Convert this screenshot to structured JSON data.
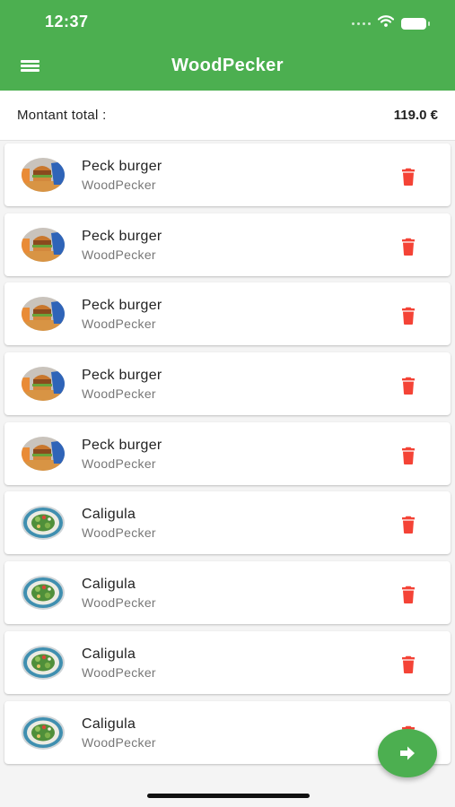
{
  "status_bar": {
    "time": "12:37"
  },
  "app_bar": {
    "title": "WoodPecker",
    "menu_icon": "hamburger-icon"
  },
  "cart": {
    "total_label": "Montant total :",
    "total_value": "119.0 €",
    "items": [
      {
        "name": "Peck burger",
        "restaurant": "WoodPecker",
        "thumb": "burger"
      },
      {
        "name": "Peck burger",
        "restaurant": "WoodPecker",
        "thumb": "burger"
      },
      {
        "name": "Peck burger",
        "restaurant": "WoodPecker",
        "thumb": "burger"
      },
      {
        "name": "Peck burger",
        "restaurant": "WoodPecker",
        "thumb": "burger"
      },
      {
        "name": "Peck burger",
        "restaurant": "WoodPecker",
        "thumb": "burger"
      },
      {
        "name": "Caligula",
        "restaurant": "WoodPecker",
        "thumb": "salad"
      },
      {
        "name": "Caligula",
        "restaurant": "WoodPecker",
        "thumb": "salad"
      },
      {
        "name": "Caligula",
        "restaurant": "WoodPecker",
        "thumb": "salad"
      },
      {
        "name": "Caligula",
        "restaurant": "WoodPecker",
        "thumb": "salad"
      }
    ]
  },
  "checkout_button": {
    "icon": "arrow-right-icon"
  },
  "colors": {
    "primary": "#4caf50",
    "delete": "#f44336",
    "text": "#222222",
    "secondary_text": "#777777"
  }
}
